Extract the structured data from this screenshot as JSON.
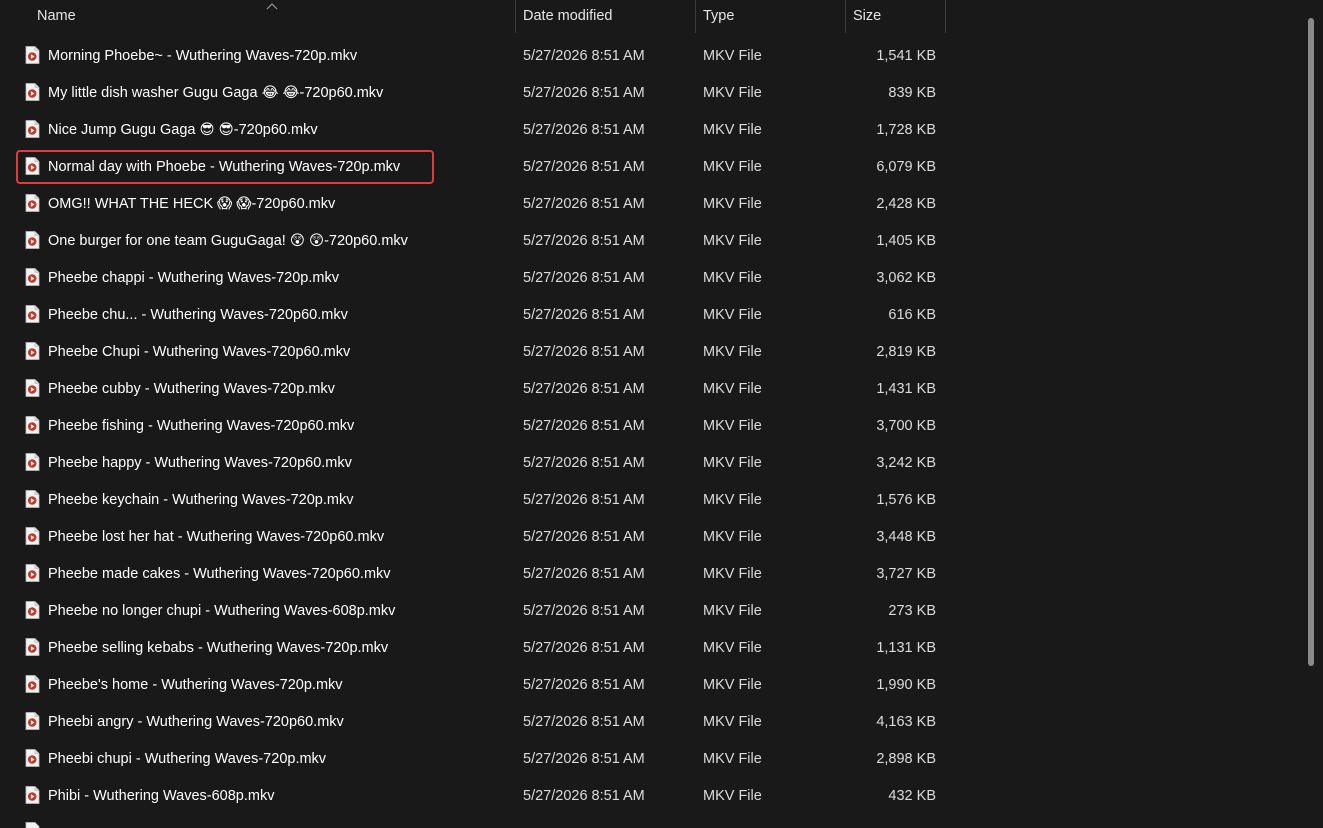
{
  "columns": {
    "name": "Name",
    "date_modified": "Date modified",
    "type": "Type",
    "size": "Size"
  },
  "sort": {
    "column": "name",
    "direction": "ascending",
    "indicator_icon": "chevron-up-icon"
  },
  "file_icon": "video-file-icon",
  "highlight_color": "#e23b3b",
  "files": [
    {
      "name": "Morning Phoebe~ - Wuthering Waves-720p.mkv",
      "date": "5/27/2026 8:51 AM",
      "type": "MKV File",
      "size": "1,541 KB"
    },
    {
      "name": "My little dish washer Gugu Gaga 😂 😂-720p60.mkv",
      "date": "5/27/2026 8:51 AM",
      "type": "MKV File",
      "size": "839 KB"
    },
    {
      "name": "Nice Jump Gugu Gaga 😎 😎-720p60.mkv",
      "date": "5/27/2026 8:51 AM",
      "type": "MKV File",
      "size": "1,728 KB"
    },
    {
      "name": "Normal day with Phoebe - Wuthering Waves-720p.mkv",
      "date": "5/27/2026 8:51 AM",
      "type": "MKV File",
      "size": "6,079 KB",
      "highlighted": true
    },
    {
      "name": "OMG!! WHAT THE HECK 😱 😱-720p60.mkv",
      "date": "5/27/2026 8:51 AM",
      "type": "MKV File",
      "size": "2,428 KB"
    },
    {
      "name": "One burger for one team GuguGaga! 😲 😲-720p60.mkv",
      "date": "5/27/2026 8:51 AM",
      "type": "MKV File",
      "size": "1,405 KB"
    },
    {
      "name": "Pheebe chappi - Wuthering Waves-720p.mkv",
      "date": "5/27/2026 8:51 AM",
      "type": "MKV File",
      "size": "3,062 KB"
    },
    {
      "name": "Pheebe chu... - Wuthering Waves-720p60.mkv",
      "date": "5/27/2026 8:51 AM",
      "type": "MKV File",
      "size": "616 KB"
    },
    {
      "name": "Pheebe Chupi - Wuthering Waves-720p60.mkv",
      "date": "5/27/2026 8:51 AM",
      "type": "MKV File",
      "size": "2,819 KB"
    },
    {
      "name": "Pheebe cubby - Wuthering Waves-720p.mkv",
      "date": "5/27/2026 8:51 AM",
      "type": "MKV File",
      "size": "1,431 KB"
    },
    {
      "name": "Pheebe fishing - Wuthering Waves-720p60.mkv",
      "date": "5/27/2026 8:51 AM",
      "type": "MKV File",
      "size": "3,700 KB"
    },
    {
      "name": "Pheebe happy - Wuthering Waves-720p60.mkv",
      "date": "5/27/2026 8:51 AM",
      "type": "MKV File",
      "size": "3,242 KB"
    },
    {
      "name": "Pheebe keychain - Wuthering Waves-720p.mkv",
      "date": "5/27/2026 8:51 AM",
      "type": "MKV File",
      "size": "1,576 KB"
    },
    {
      "name": "Pheebe lost her hat - Wuthering Waves-720p60.mkv",
      "date": "5/27/2026 8:51 AM",
      "type": "MKV File",
      "size": "3,448 KB"
    },
    {
      "name": "Pheebe made cakes - Wuthering Waves-720p60.mkv",
      "date": "5/27/2026 8:51 AM",
      "type": "MKV File",
      "size": "3,727 KB"
    },
    {
      "name": "Pheebe no longer chupi - Wuthering Waves-608p.mkv",
      "date": "5/27/2026 8:51 AM",
      "type": "MKV File",
      "size": "273 KB"
    },
    {
      "name": "Pheebe selling kebabs - Wuthering Waves-720p.mkv",
      "date": "5/27/2026 8:51 AM",
      "type": "MKV File",
      "size": "1,131 KB"
    },
    {
      "name": "Pheebe's home - Wuthering Waves-720p.mkv",
      "date": "5/27/2026 8:51 AM",
      "type": "MKV File",
      "size": "1,990 KB"
    },
    {
      "name": "Pheebi angry - Wuthering Waves-720p60.mkv",
      "date": "5/27/2026 8:51 AM",
      "type": "MKV File",
      "size": "4,163 KB"
    },
    {
      "name": "Pheebi chupi - Wuthering Waves-720p.mkv",
      "date": "5/27/2026 8:51 AM",
      "type": "MKV File",
      "size": "2,898 KB"
    },
    {
      "name": "Phibi - Wuthering Waves-608p.mkv",
      "date": "5/27/2026 8:51 AM",
      "type": "MKV File",
      "size": "432 KB"
    }
  ]
}
